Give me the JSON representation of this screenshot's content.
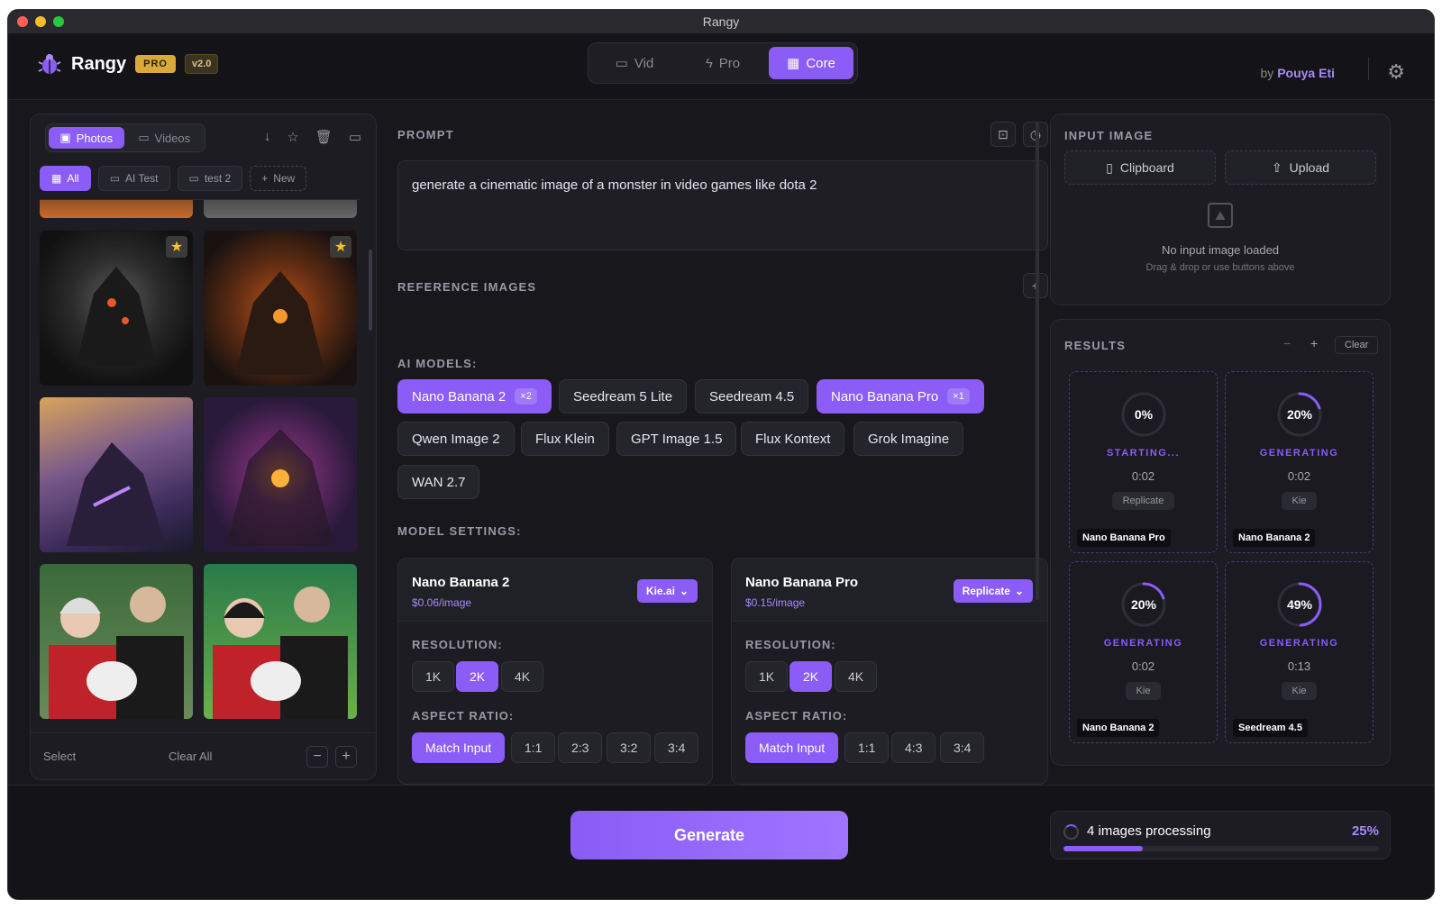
{
  "window": {
    "title": "Rangy"
  },
  "brand": {
    "name": "Rangy",
    "pro_badge": "PRO",
    "version": "v2.0",
    "by": "by",
    "author": "Pouya Eti"
  },
  "mode_tabs": [
    {
      "label": "Vid",
      "icon": "video-icon"
    },
    {
      "label": "Pro",
      "icon": "bolt-icon"
    },
    {
      "label": "Core",
      "icon": "grid-icon",
      "active": true
    }
  ],
  "gallery": {
    "tabs": [
      {
        "label": "Photos",
        "active": true
      },
      {
        "label": "Videos"
      }
    ],
    "folders": [
      {
        "label": "All",
        "active": true
      },
      {
        "label": "AI Test"
      },
      {
        "label": "test 2"
      },
      {
        "label": "New"
      }
    ],
    "footer": {
      "select": "Select",
      "clear_all": "Clear All",
      "zoom_out": "−",
      "zoom_in": "+"
    }
  },
  "prompt": {
    "label": "PROMPT",
    "value": "generate a cinematic image of a monster in video games like dota 2"
  },
  "reference_images": {
    "label": "REFERENCE IMAGES",
    "add": "+"
  },
  "ai_models": {
    "label": "AI MODELS:",
    "items": [
      {
        "label": "Nano Banana 2",
        "count": "×2",
        "active": true
      },
      {
        "label": "Seedream 5 Lite"
      },
      {
        "label": "Seedream 4.5"
      },
      {
        "label": "Nano Banana Pro",
        "count": "×1",
        "active": true
      },
      {
        "label": "Qwen Image 2"
      },
      {
        "label": "Flux Klein"
      },
      {
        "label": "GPT Image 1.5"
      },
      {
        "label": "Flux Kontext"
      },
      {
        "label": "Grok Imagine"
      },
      {
        "label": "WAN 2.7"
      }
    ]
  },
  "model_settings": {
    "label": "MODEL SETTINGS:",
    "cards": [
      {
        "title": "Nano Banana 2",
        "price": "$0.06/image",
        "provider": "Kie.ai",
        "resolution_label": "RESOLUTION:",
        "resolutions": [
          "1K",
          "2K",
          "4K"
        ],
        "resolution_selected": "2K",
        "aspect_label": "ASPECT RATIO:",
        "aspects": [
          "Match Input",
          "1:1",
          "2:3",
          "3:2",
          "3:4"
        ]
      },
      {
        "title": "Nano Banana Pro",
        "price": "$0.15/image",
        "provider": "Replicate",
        "resolution_label": "RESOLUTION:",
        "resolutions": [
          "1K",
          "2K",
          "4K"
        ],
        "resolution_selected": "2K",
        "aspect_label": "ASPECT RATIO:",
        "aspects": [
          "Match Input",
          "1:1",
          "4:3",
          "3:4"
        ]
      }
    ]
  },
  "input_image": {
    "label": "INPUT IMAGE",
    "clipboard": "Clipboard",
    "upload": "Upload",
    "empty_title": "No input image loaded",
    "empty_hint": "Drag & drop or use buttons above"
  },
  "results": {
    "label": "RESULTS",
    "minus": "−",
    "plus": "+",
    "clear": "Clear",
    "tiles": [
      {
        "percent": "0%",
        "progress": 0,
        "status": "STARTING...",
        "time": "0:02",
        "provider": "Replicate",
        "model": "Nano Banana Pro"
      },
      {
        "percent": "20%",
        "progress": 20,
        "status": "GENERATING",
        "time": "0:02",
        "provider": "Kie",
        "model": "Nano Banana 2"
      },
      {
        "percent": "20%",
        "progress": 20,
        "status": "GENERATING",
        "time": "0:02",
        "provider": "Kie",
        "model": "Nano Banana 2"
      },
      {
        "percent": "49%",
        "progress": 49,
        "status": "GENERATING",
        "time": "0:13",
        "provider": "Kie",
        "model": "Seedream 4.5"
      }
    ]
  },
  "footer": {
    "generate": "Generate",
    "processing_text": "4 images processing",
    "processing_percent": "25%",
    "processing_progress": 25
  },
  "colors": {
    "accent": "#8b5cf6",
    "gold": "#d9a93a",
    "bg": "#17171c"
  }
}
